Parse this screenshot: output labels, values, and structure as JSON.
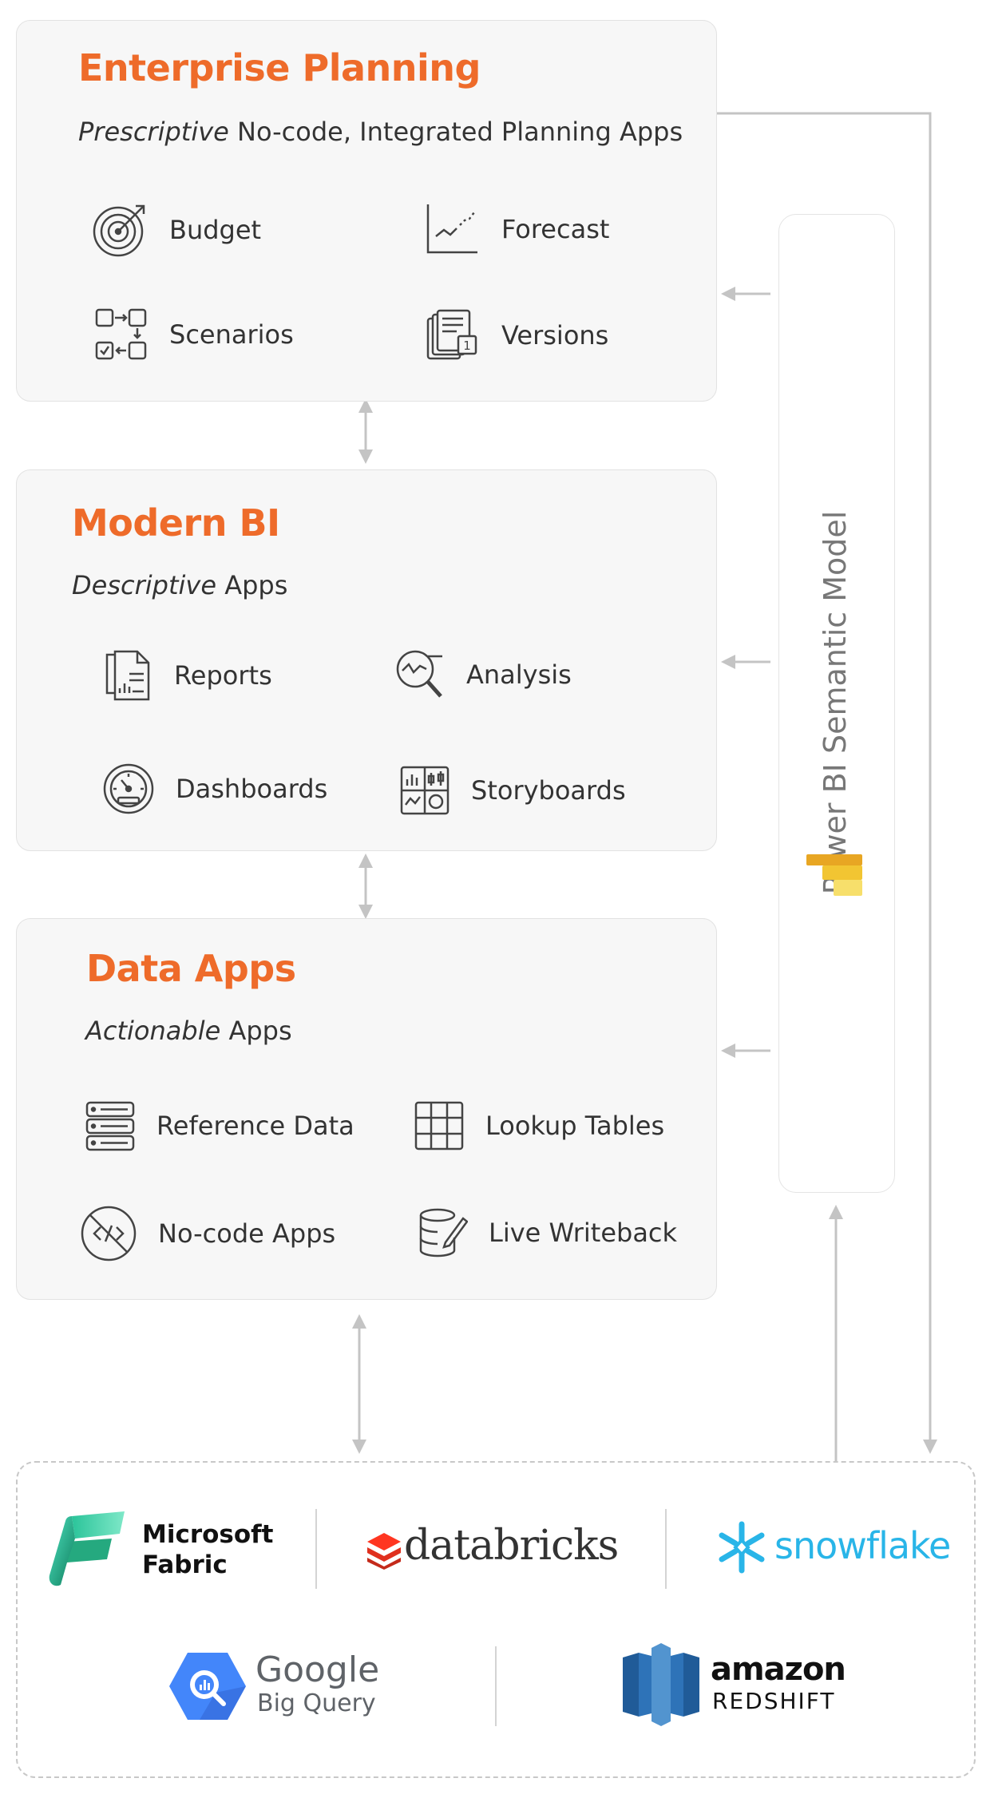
{
  "panels": {
    "enterprise_planning": {
      "title": "Enterprise Planning",
      "subtitle_em": "Prescriptive",
      "subtitle_rest": " No-code, Integrated Planning Apps",
      "items": [
        {
          "label": "Budget",
          "icon": "target-icon"
        },
        {
          "label": "Forecast",
          "icon": "trend-chart-icon"
        },
        {
          "label": "Scenarios",
          "icon": "workflow-icon"
        },
        {
          "label": "Versions",
          "icon": "document-stack-icon"
        }
      ]
    },
    "modern_bi": {
      "title": "Modern BI",
      "subtitle_em": "Descriptive",
      "subtitle_rest": " Apps",
      "items": [
        {
          "label": "Reports",
          "icon": "report-icon"
        },
        {
          "label": "Analysis",
          "icon": "magnifier-chart-icon"
        },
        {
          "label": "Dashboards",
          "icon": "gauge-icon"
        },
        {
          "label": "Storyboards",
          "icon": "storyboard-icon"
        }
      ]
    },
    "data_apps": {
      "title": "Data Apps",
      "subtitle_em": "Actionable",
      "subtitle_rest": " Apps",
      "items": [
        {
          "label": "Reference Data",
          "icon": "server-icon"
        },
        {
          "label": "Lookup Tables",
          "icon": "grid-table-icon"
        },
        {
          "label": "No-code Apps",
          "icon": "no-code-icon"
        },
        {
          "label": "Live Writeback",
          "icon": "database-edit-icon"
        }
      ]
    }
  },
  "semantic_model": {
    "label": "Power BI Semantic Model",
    "icon": "power-bi-icon"
  },
  "sources": {
    "microsoft_fabric": {
      "line1": "Microsoft",
      "line2": "Fabric"
    },
    "databricks": {
      "name": "databricks"
    },
    "snowflake": {
      "name": "snowflake"
    },
    "google": {
      "line1": "Google",
      "line2": "Big Query"
    },
    "amazon": {
      "line1": "amazon",
      "line2": "REDSHIFT"
    }
  },
  "colors": {
    "accent": "#ee6b2a",
    "arrow": "#c4c4c4",
    "panel_bg": "#f7f7f7"
  }
}
